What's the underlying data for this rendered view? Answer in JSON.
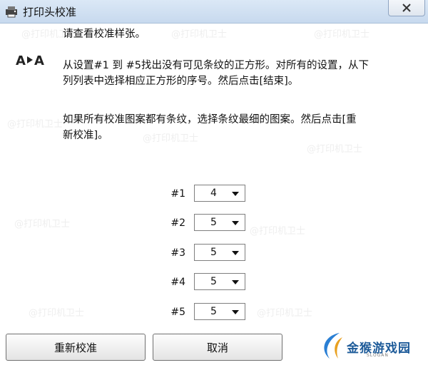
{
  "window": {
    "title": "打印头校准"
  },
  "instructions": {
    "heading": "请查看校准样张。",
    "para1_line1": "从设置#1 到 #5找出没有可见条纹的正方形。对所有的设置，从下",
    "para1_line2": "列列表中选择相应正方形的序号。然后点击[结束]。",
    "para2_line1": "如果所有校准图案都有条纹，选择条纹最细的图案。然后点击[重",
    "para2_line2": "新校准]。"
  },
  "settings": [
    {
      "label": "#1",
      "value": "4"
    },
    {
      "label": "#2",
      "value": "5"
    },
    {
      "label": "#3",
      "value": "5"
    },
    {
      "label": "#4",
      "value": "5"
    },
    {
      "label": "#5",
      "value": "5"
    }
  ],
  "buttons": {
    "recalibrate": "重新校准",
    "cancel": "取消"
  },
  "watermark": {
    "text": "@打印机卫士"
  },
  "logo": {
    "text": "金猴游戏园",
    "sub": "SLOGAN"
  },
  "colors": {
    "titlebar": "#c7d9ee",
    "logo_blue": "#1f5c9a"
  }
}
